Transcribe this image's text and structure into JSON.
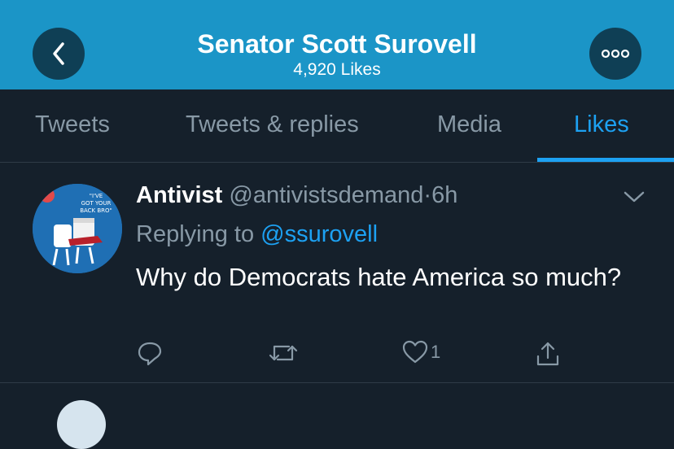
{
  "header": {
    "title": "Senator Scott Surovell",
    "subtitle": "4,920 Likes",
    "back_icon": "chevron-left-icon",
    "more_icon": "more-horizontal-icon",
    "color": "#1b95c7"
  },
  "tabs": [
    {
      "label": "Tweets"
    },
    {
      "label": "Tweets & replies"
    },
    {
      "label": "Media"
    },
    {
      "label": "Likes",
      "active": true
    }
  ],
  "tweet": {
    "author_name": "Antivist",
    "handle": "@antivistsdemand",
    "separator": "·",
    "time": "6h",
    "replying_prefix": "Replying to",
    "replying_to": "@ssurovell",
    "text": "Why do Democrats hate America so much?",
    "avatar_caption": "\"I'VE GOT YOUR BACK BRO\"",
    "like_count": "1"
  },
  "colors": {
    "background": "#15202b",
    "accent": "#1da1f2",
    "muted": "#8899a6"
  }
}
